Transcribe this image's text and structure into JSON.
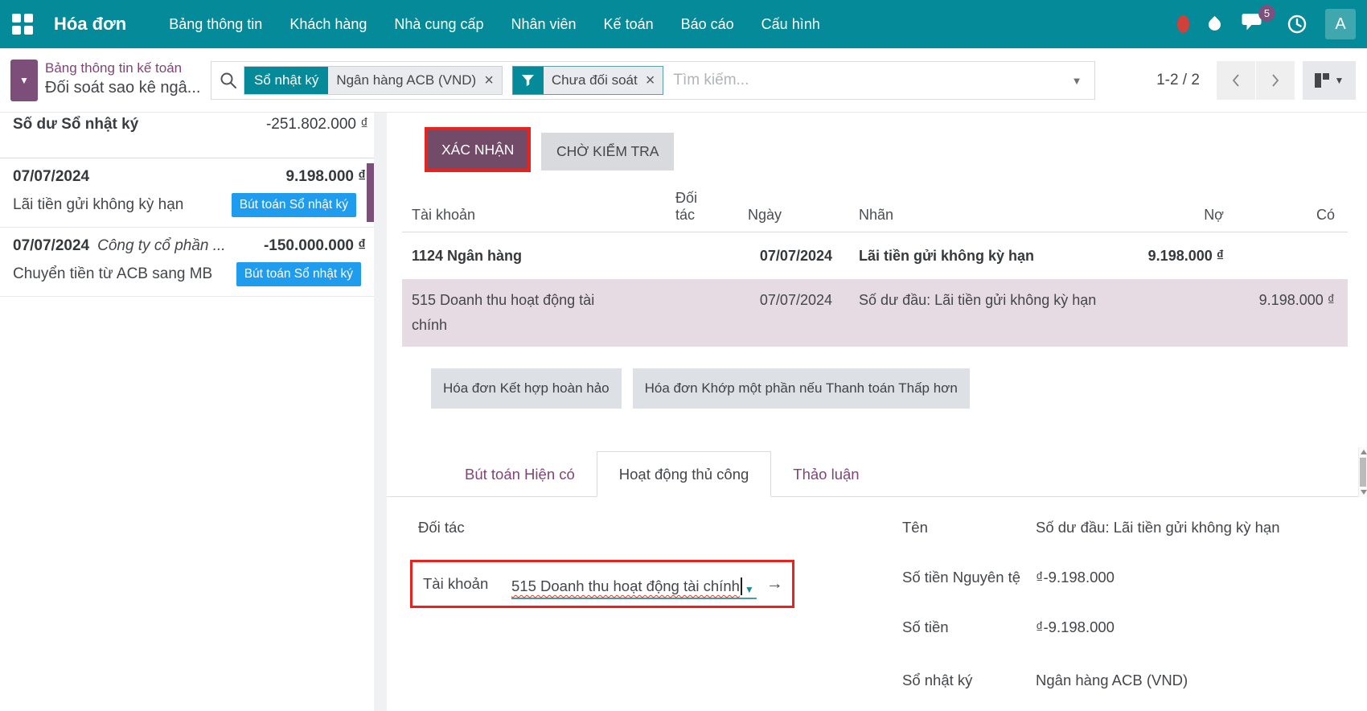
{
  "nav": {
    "app_title": "Hóa đơn",
    "items": [
      "Bảng thông tin",
      "Khách hàng",
      "Nhà cung cấp",
      "Nhân viên",
      "Kế toán",
      "Báo cáo",
      "Cấu hình"
    ],
    "chat_badge": "5",
    "avatar_initial": "A"
  },
  "breadcrumb": {
    "parent": "Bảng thông tin kế toán",
    "current": "Đối soát sao kê ngâ..."
  },
  "search": {
    "journal_facet_label": "Sổ nhật ký",
    "journal_facet_value": "Ngân hàng ACB (VND)",
    "filter_facet_value": "Chưa đối soát",
    "placeholder": "Tìm kiếm..."
  },
  "pager": {
    "range": "1-2 / 2"
  },
  "left_panel": {
    "balance_label": "Số dư Sổ nhật ký",
    "balance_value": "-251.802.000 ₫",
    "items": [
      {
        "date": "07/07/2024",
        "partner": "",
        "amount": "9.198.000 ₫",
        "label": "Lãi tiền gửi không kỳ hạn",
        "badge": "Bút toán Sổ nhật ký"
      },
      {
        "date": "07/07/2024",
        "partner": "Công ty cổ phần ...",
        "amount": "-150.000.000 ₫",
        "label": "Chuyển tiền từ ACB sang MB",
        "badge": "Bút toán Sổ nhật ký"
      }
    ]
  },
  "main": {
    "validate_label": "XÁC NHẬN",
    "check_label": "CHỜ KIỂM TRA",
    "table": {
      "col_account": "Tài khoản",
      "col_partner": "Đối tác",
      "col_date": "Ngày",
      "col_label": "Nhãn",
      "col_debit": "Nợ",
      "col_credit": "Có",
      "rows": [
        {
          "account": "1124 Ngân hàng",
          "partner": "",
          "date": "07/07/2024",
          "label": "Lãi tiền gửi không kỳ hạn",
          "debit": "9.198.000 ₫",
          "credit": ""
        },
        {
          "account": "515 Doanh thu hoạt động tài chính",
          "partner": "",
          "date": "07/07/2024",
          "label": "Số dư đầu: Lãi tiền gửi không kỳ hạn",
          "debit": "",
          "credit": "9.198.000 ₫"
        }
      ]
    },
    "match_buttons": [
      "Hóa đơn Kết hợp hoàn hảo",
      "Hóa đơn Khớp một phần nếu Thanh toán Thấp hơn"
    ],
    "tabs": [
      "Bút toán Hiện có",
      "Hoạt động thủ công",
      "Thảo luận"
    ],
    "form": {
      "partner_label": "Đối tác",
      "account_label": "Tài khoản",
      "account_value": "515 Doanh thu hoạt động tài chính",
      "name_label": "Tên",
      "name_value": "Số dư đầu: Lãi tiền gửi không kỳ hạn",
      "amount_currency_label": "Số tiền Nguyên tệ",
      "amount_currency_value": "₫-9.198.000",
      "amount_label": "Số tiền",
      "amount_value": "₫-9.198.000",
      "journal_label": "Sổ nhật ký",
      "journal_value": "Ngân hàng ACB (VND)"
    }
  },
  "colors": {
    "navbar_teal": "#048a98",
    "button_purple": "#714b67",
    "link_purple": "#7e4576",
    "badge_blue": "#1f9ced",
    "highlight_row_pink": "#e6dae3",
    "alert_red": "#e8231d"
  }
}
